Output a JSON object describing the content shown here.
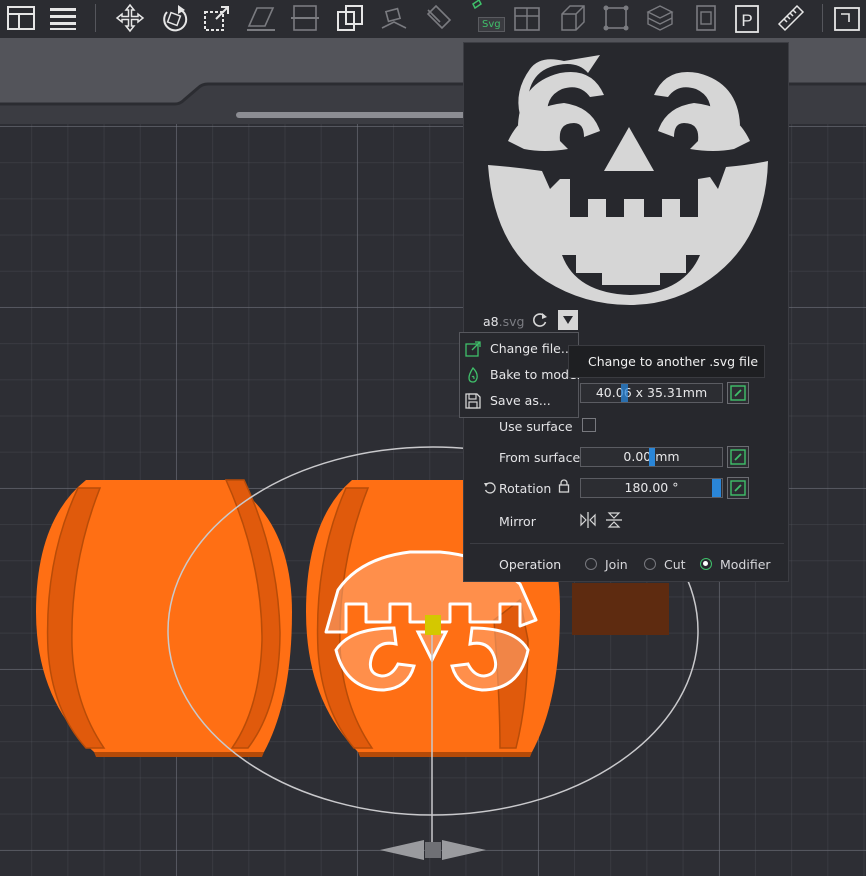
{
  "toolbar": {
    "svg_tool_label": "Svg",
    "tools": [
      "layout-icon",
      "list-icon",
      "move-icon",
      "rotate-icon",
      "scale-icon",
      "lay-on-face-icon",
      "cut-icon",
      "split-icon",
      "arrange-icon",
      "support-paint-icon",
      "seam-paint-icon",
      "svg-icon",
      "hollow-icon",
      "measure-box-icon",
      "assembly-icon",
      "text-emboss-icon",
      "negative-part-icon",
      "place-icon",
      "ruler-icon",
      "extra-icon"
    ]
  },
  "emboss_panel": {
    "file_name": "a8",
    "file_ext": ".svg",
    "size_value": "40.06 x 35.31mm",
    "use_surface_label": "Use surface",
    "from_surface_label": "From surface",
    "from_surface_value": "0.00 mm",
    "rotation_label": "Rotation",
    "rotation_value": "180.00 °",
    "mirror_label": "Mirror",
    "operation_label": "Operation",
    "operations": [
      {
        "label": "Join",
        "selected": false
      },
      {
        "label": "Cut",
        "selected": false
      },
      {
        "label": "Modifier",
        "selected": true
      }
    ]
  },
  "file_menu": {
    "items": [
      {
        "label": "Change file...",
        "icon": "external-link-icon"
      },
      {
        "label": "Bake to model",
        "icon": "bake-icon"
      },
      {
        "label": "Save as...",
        "icon": "save-icon"
      }
    ]
  },
  "tooltip": "Change to another .svg file",
  "colors": {
    "accent": "#3fc06a",
    "model": "#ff6a12",
    "highlight": "#2a86d8"
  }
}
